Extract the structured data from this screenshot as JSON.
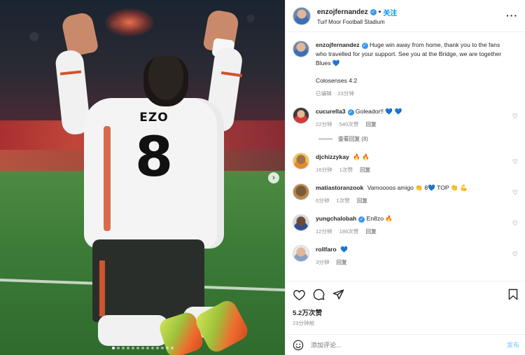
{
  "header": {
    "username": "enzojfernandez",
    "follow_label": "关注",
    "location": "Turf Moor Football Stadium",
    "more_label": "···"
  },
  "media": {
    "jersey_name": "EZO",
    "jersey_number": "8",
    "next_label": "›",
    "slide_count": 13,
    "active_slide": 1
  },
  "caption": {
    "username": "enzojfernandez",
    "text": "Huge win away from home, thank you to the fans who travelled for your support. See you at the Bridge, we are together Blues 💙",
    "extra": "Colosenses 4:2",
    "edited": "已编辑",
    "time": "23分钟"
  },
  "comments": [
    {
      "username": "cucurella3",
      "verified": true,
      "text": "Goleador!! 💙 💙",
      "time": "22分钟",
      "likes": "540次赞",
      "reply_label": "回复",
      "view_replies": "查看回复 (8)"
    },
    {
      "username": "djchizzykay",
      "verified": false,
      "text": "🔥 🔥",
      "time": "16分钟",
      "likes": "1次赞",
      "reply_label": "回复"
    },
    {
      "username": "matiastoranzook",
      "verified": false,
      "text": "Vamoooos amigo 👏 8💙 TOP 👏 💪",
      "time": "6分钟",
      "likes": "1次赞",
      "reply_label": "回复"
    },
    {
      "username": "yungchalobah",
      "verified": true,
      "text": "En8zo 🔥",
      "time": "12分钟",
      "likes": "186次赞",
      "reply_label": "回复"
    },
    {
      "username": "rollfaro",
      "verified": false,
      "text": "💙",
      "time": "3分钟",
      "likes": "",
      "reply_label": "回复"
    }
  ],
  "actions": {
    "likes": "5.2万次赞",
    "time": "23分钟前",
    "comment_placeholder": "添加评论...",
    "post_label": "发布"
  },
  "icons": {
    "like": "heart-icon",
    "comment": "comment-icon",
    "share": "paper-plane-icon",
    "save": "bookmark-icon",
    "emoji": "smiley-icon",
    "verified": "verified-badge-icon"
  },
  "colors": {
    "accent": "#0095f6",
    "verified": "#3897f0",
    "secondary_text": "#8e8e8e"
  }
}
